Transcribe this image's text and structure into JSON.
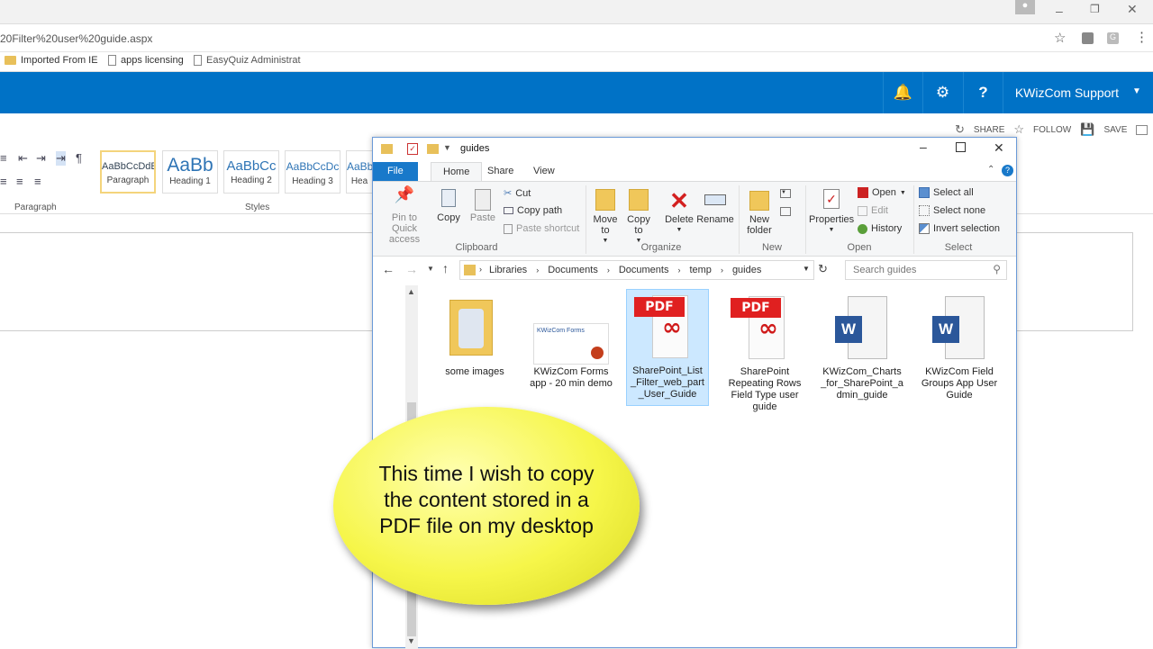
{
  "browser": {
    "url": "20Filter%20user%20guide.aspx",
    "bookmarks": [
      "Imported From IE",
      "apps licensing",
      "EasyQuiz Administrat"
    ]
  },
  "sharepoint": {
    "user": "KWizCom Support",
    "actions": {
      "share": "SHARE",
      "follow": "FOLLOW",
      "save": "SAVE"
    },
    "accent": "#0072c6"
  },
  "word_ribbon": {
    "styles": [
      {
        "preview": "AaBbCcDdE",
        "name": "Paragraph"
      },
      {
        "preview": "AaBb",
        "name": "Heading 1"
      },
      {
        "preview": "AaBbCc",
        "name": "Heading 2"
      },
      {
        "preview": "AaBbCcDc",
        "name": "Heading 3"
      },
      {
        "preview": "AaBb",
        "name": "Hea"
      }
    ],
    "group_paragraph": "Paragraph",
    "group_styles": "Styles"
  },
  "explorer": {
    "title": "guides",
    "tabs": {
      "file": "File",
      "home": "Home",
      "share": "Share",
      "view": "View"
    },
    "ribbon": {
      "pin": "Pin to Quick access",
      "copy": "Copy",
      "paste": "Paste",
      "cut": "Cut",
      "copy_path": "Copy path",
      "paste_shortcut": "Paste shortcut",
      "move_to": "Move to",
      "copy_to": "Copy to",
      "delete": "Delete",
      "rename": "Rename",
      "new_folder": "New folder",
      "properties": "Properties",
      "open": "Open",
      "edit": "Edit",
      "history": "History",
      "select_all": "Select all",
      "select_none": "Select none",
      "invert_selection": "Invert selection",
      "groups": {
        "clipboard": "Clipboard",
        "organize": "Organize",
        "new": "New",
        "open": "Open",
        "select": "Select"
      }
    },
    "breadcrumb": [
      "Libraries",
      "Documents",
      "Documents",
      "temp",
      "guides"
    ],
    "search_placeholder": "Search guides",
    "files": [
      {
        "name": "some images",
        "type": "folder"
      },
      {
        "name": "KWizCom Forms app - 20 min demo",
        "type": "video"
      },
      {
        "name": "SharePoint_List_Filter_web_part_User_Guide",
        "type": "pdf",
        "selected": true
      },
      {
        "name": "SharePoint Repeating Rows Field Type user guide",
        "type": "pdf"
      },
      {
        "name": "KWizCom_Charts_for_SharePoint_admin_guide",
        "type": "word"
      },
      {
        "name": "KWizCom Field Groups App User Guide",
        "type": "word"
      }
    ],
    "thumb_label": "KWizCom Forms"
  },
  "callout": {
    "text": "This time I wish to copy the content stored in a PDF file on my desktop"
  }
}
